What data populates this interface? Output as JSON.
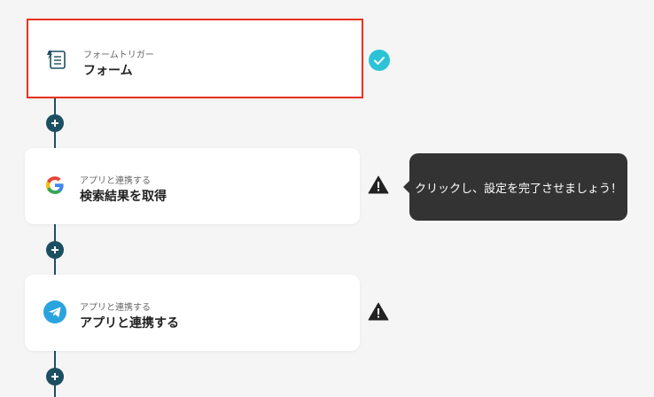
{
  "steps": [
    {
      "sub": "フォームトリガー",
      "title": "フォーム",
      "icon": "form-icon",
      "status": "complete"
    },
    {
      "sub": "アプリと連携する",
      "title": "検索結果を取得",
      "icon": "google-icon",
      "status": "warning"
    },
    {
      "sub": "アプリと連携する",
      "title": "アプリと連携する",
      "icon": "telegram-icon",
      "status": "warning"
    }
  ],
  "tooltip": {
    "text": "クリックし、設定を完了させましょう！"
  },
  "colors": {
    "connector": "#1d4f63",
    "check": "#2bc3d6",
    "selected_border": "#e8321c",
    "tooltip_bg": "#333333"
  }
}
